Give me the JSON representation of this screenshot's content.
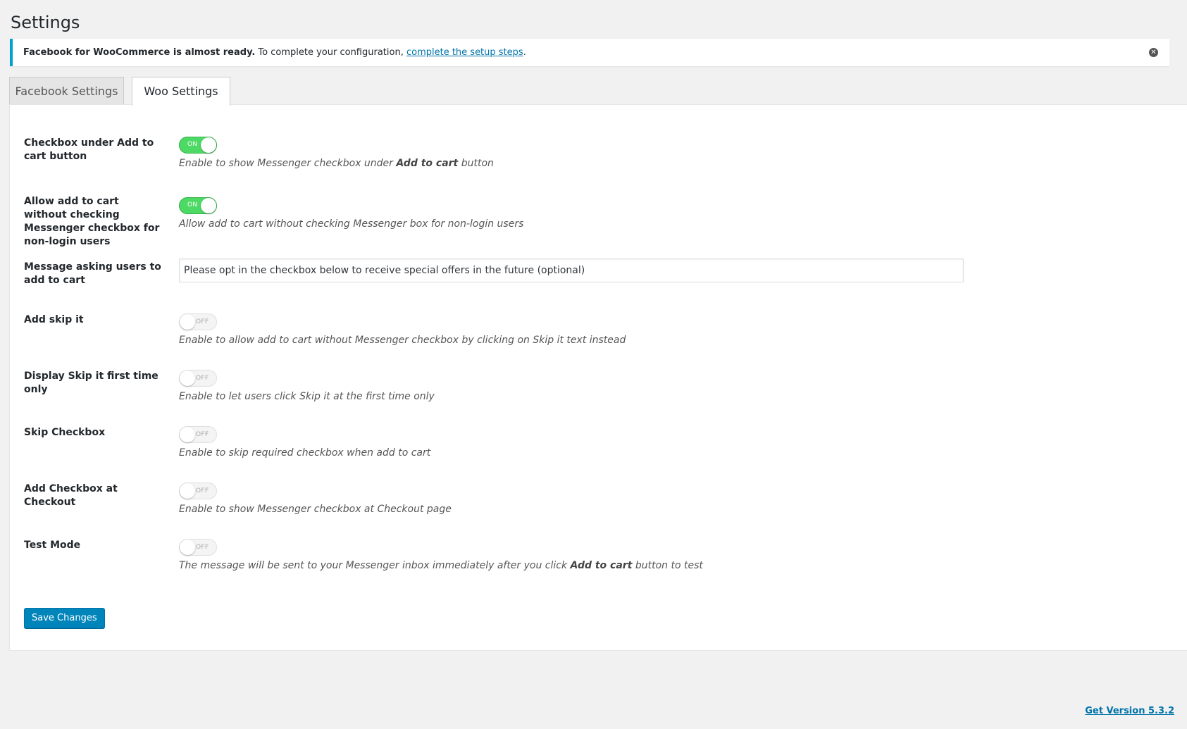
{
  "page": {
    "title": "Settings"
  },
  "notice": {
    "lead": "Facebook for WooCommerce is almost ready.",
    "text": " To complete your configuration, ",
    "link": "complete the setup steps",
    "tail": "."
  },
  "tabs": [
    {
      "label": "Facebook Settings",
      "active": false
    },
    {
      "label": "Woo Settings",
      "active": true
    }
  ],
  "settings": {
    "checkbox_under_cart": {
      "label": "Checkbox under Add to cart button",
      "state": "ON",
      "desc_a": "Enable to show Messenger checkbox under ",
      "desc_b": "Add to cart",
      "desc_c": " button"
    },
    "allow_without_checkbox": {
      "label": "Allow add to cart without checking Messenger checkbox for non-login users",
      "state": "ON",
      "desc": "Allow add to cart without checking Messenger box for non-login users"
    },
    "message": {
      "label": "Message asking users to add to cart",
      "value": "Please opt in the checkbox below to receive special offers in the future (optional)"
    },
    "add_skip_it": {
      "label": "Add skip it",
      "state": "OFF",
      "desc": "Enable to allow add to cart without Messenger checkbox by clicking on Skip it text instead"
    },
    "skip_first_time": {
      "label": "Display Skip it first time only",
      "state": "OFF",
      "desc": "Enable to let users click Skip it at the first time only"
    },
    "skip_checkbox": {
      "label": "Skip Checkbox",
      "state": "OFF",
      "desc": "Enable to skip required checkbox when add to cart"
    },
    "checkbox_at_checkout": {
      "label": "Add Checkbox at Checkout",
      "state": "OFF",
      "desc": "Enable to show Messenger checkbox at Checkout page"
    },
    "test_mode": {
      "label": "Test Mode",
      "state": "OFF",
      "desc_a": "The message will be sent to your Messenger inbox immediately after you click ",
      "desc_b": "Add to cart",
      "desc_c": " button to test"
    }
  },
  "save_label": "Save Changes",
  "footer": {
    "version_link": "Get Version 5.3.2"
  },
  "colors": {
    "accent": "#0085ba",
    "toggle_on": "#4cd964",
    "notice_border": "#00a0d2"
  }
}
